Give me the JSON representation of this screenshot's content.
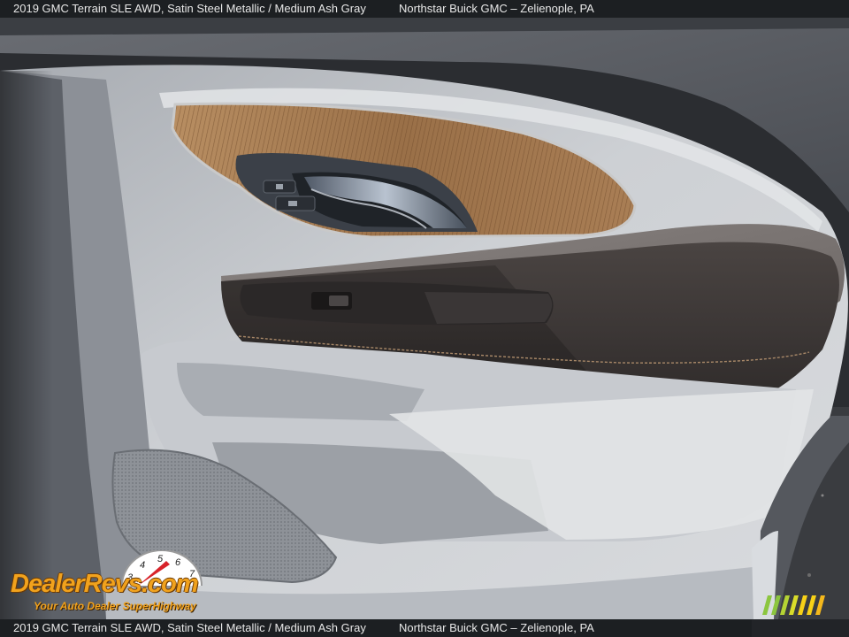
{
  "caption": {
    "vehicle": "2019 GMC Terrain SLE AWD,  Satin Steel Metallic / Medium Ash Gray",
    "dealer": "Northstar Buick GMC – Zelienople, PA"
  },
  "watermark": {
    "logo_text": "DealerRevs.com",
    "tagline": "Your Auto Dealer SuperHighway",
    "gauge_numbers": "3 4 5 6 7"
  },
  "colors": {
    "logo_orange": "#f1a21d",
    "gauge_red": "#d8232a",
    "stripe_green": "#8cc63f",
    "stripe_yellow": "#f7d117"
  }
}
